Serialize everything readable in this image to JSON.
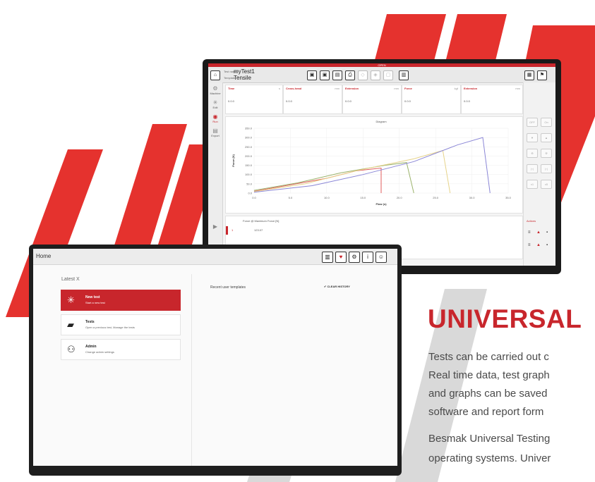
{
  "colors": {
    "accent": "#c8262c",
    "stripe": "#e5322e",
    "grey_stripe": "#d9d9d9"
  },
  "top_window": {
    "app_title": "OPEN",
    "test_name_label": "Test name",
    "test_name": "myTest1",
    "template_label": "Template",
    "template": "Tensile",
    "nav": [
      {
        "label": "Machine",
        "icon": "gear-icon"
      },
      {
        "label": "Edit",
        "icon": "edit-icon"
      },
      {
        "label": "Run",
        "icon": "run-icon"
      },
      {
        "label": "Export",
        "icon": "export-icon"
      }
    ],
    "metrics": [
      {
        "label": "Time",
        "unit": "s",
        "value": "0.0.0"
      },
      {
        "label": "Cross-head",
        "unit": "mm",
        "value": "0.0.0"
      },
      {
        "label": "Extension",
        "unit": "mm",
        "value": "0.0.0"
      },
      {
        "label": "Force",
        "unit": "kgf",
        "value": "0.0.0"
      },
      {
        "label": "Extension",
        "unit": "mm",
        "value": "0.0.0"
      }
    ],
    "right_buttons": [
      "OFF",
      "On",
      "▼",
      "▲",
      "⟰",
      "⟱",
      "|‹|",
      "|›|",
      "x1",
      "x5"
    ],
    "table_header": "Force @ Maximum Force [N]",
    "table_value": "123.07",
    "table_action_label": "Actions"
  },
  "chart_data": {
    "type": "line",
    "title": "Diagram",
    "xlabel": "Flow (s)",
    "ylabel": "Force (N)",
    "xlim": [
      0,
      35
    ],
    "ylim": [
      0,
      350
    ],
    "x_ticks": [
      "0.0",
      "5.0",
      "10.0",
      "15.0",
      "20.0",
      "25.0",
      "30.0",
      "35.0"
    ],
    "y_ticks": [
      "0.0",
      "50.0",
      "100.0",
      "150.0",
      "200.0",
      "250.0",
      "300.0",
      "350.0"
    ],
    "series": [
      {
        "color": "#e05b5b",
        "points": [
          [
            0,
            10
          ],
          [
            5,
            45
          ],
          [
            10,
            80
          ],
          [
            14,
            120
          ],
          [
            17.5,
            135
          ],
          [
            17.5,
            0
          ]
        ]
      },
      {
        "color": "#9bb36b",
        "points": [
          [
            0,
            15
          ],
          [
            6,
            55
          ],
          [
            12,
            110
          ],
          [
            18,
            150
          ],
          [
            21,
            165
          ],
          [
            22,
            0
          ]
        ]
      },
      {
        "color": "#e6d38a",
        "points": [
          [
            0,
            8
          ],
          [
            7,
            50
          ],
          [
            14,
            120
          ],
          [
            22,
            185
          ],
          [
            26,
            230
          ],
          [
            27,
            0
          ]
        ]
      },
      {
        "color": "#8a86d6",
        "points": [
          [
            0,
            5
          ],
          [
            8,
            40
          ],
          [
            15,
            100
          ],
          [
            22,
            170
          ],
          [
            28,
            260
          ],
          [
            31.5,
            300
          ],
          [
            32.5,
            0
          ]
        ]
      }
    ]
  },
  "bottom_window": {
    "title": "Home",
    "section_label": "Latest X",
    "cards": [
      {
        "title": "New test",
        "subtitle": "Start a new test",
        "icon": "new-test-icon"
      },
      {
        "title": "Tests",
        "subtitle": "Open a previous test, Manage the tests",
        "icon": "folder-icon"
      },
      {
        "title": "Admin",
        "subtitle": "Change admin settings",
        "icon": "admin-icon"
      }
    ],
    "recent_label": "Recent user templates",
    "clear_history": "CLEAR HISTORY"
  },
  "heading": "UNIVERSAL",
  "paragraphs": [
    "Tests can be carried out c",
    "Real time data, test graph",
    "and graphs can be saved",
    "software and report form",
    "Besmak Universal Testing",
    "operating systems. Univer"
  ]
}
